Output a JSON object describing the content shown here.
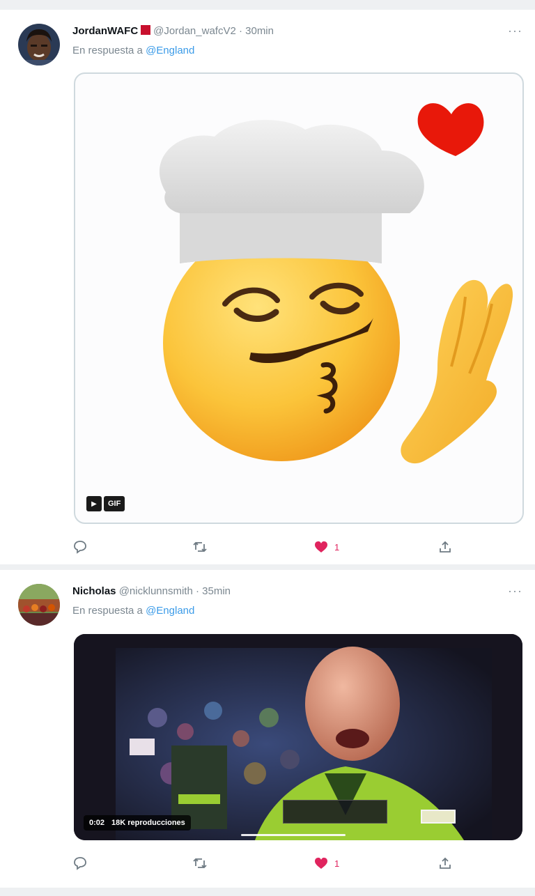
{
  "tweets": [
    {
      "name": "JordanWAFC",
      "handle": "@Jordan_wafcV2",
      "time": "· 30min",
      "reply_prefix": "En respuesta a",
      "reply_to": "@England",
      "media_type": "gif",
      "gif_label": "GIF",
      "more": "···",
      "likes": "1"
    },
    {
      "name": "Nicholas",
      "handle": "@nicklunnsmith",
      "time": "· 35min",
      "reply_prefix": "En respuesta a",
      "reply_to": "@England",
      "media_type": "video",
      "video_time": "0:02",
      "video_views": "18K reproducciones",
      "more": "···",
      "likes": "1"
    }
  ],
  "icons": {
    "reply": "reply-icon",
    "retweet": "retweet-icon",
    "like": "heart-filled-icon",
    "share": "share-icon",
    "more": "more-icon"
  },
  "colors": {
    "like": "#e0245e",
    "mention": "#3b9be8",
    "muted": "#7b8790"
  }
}
